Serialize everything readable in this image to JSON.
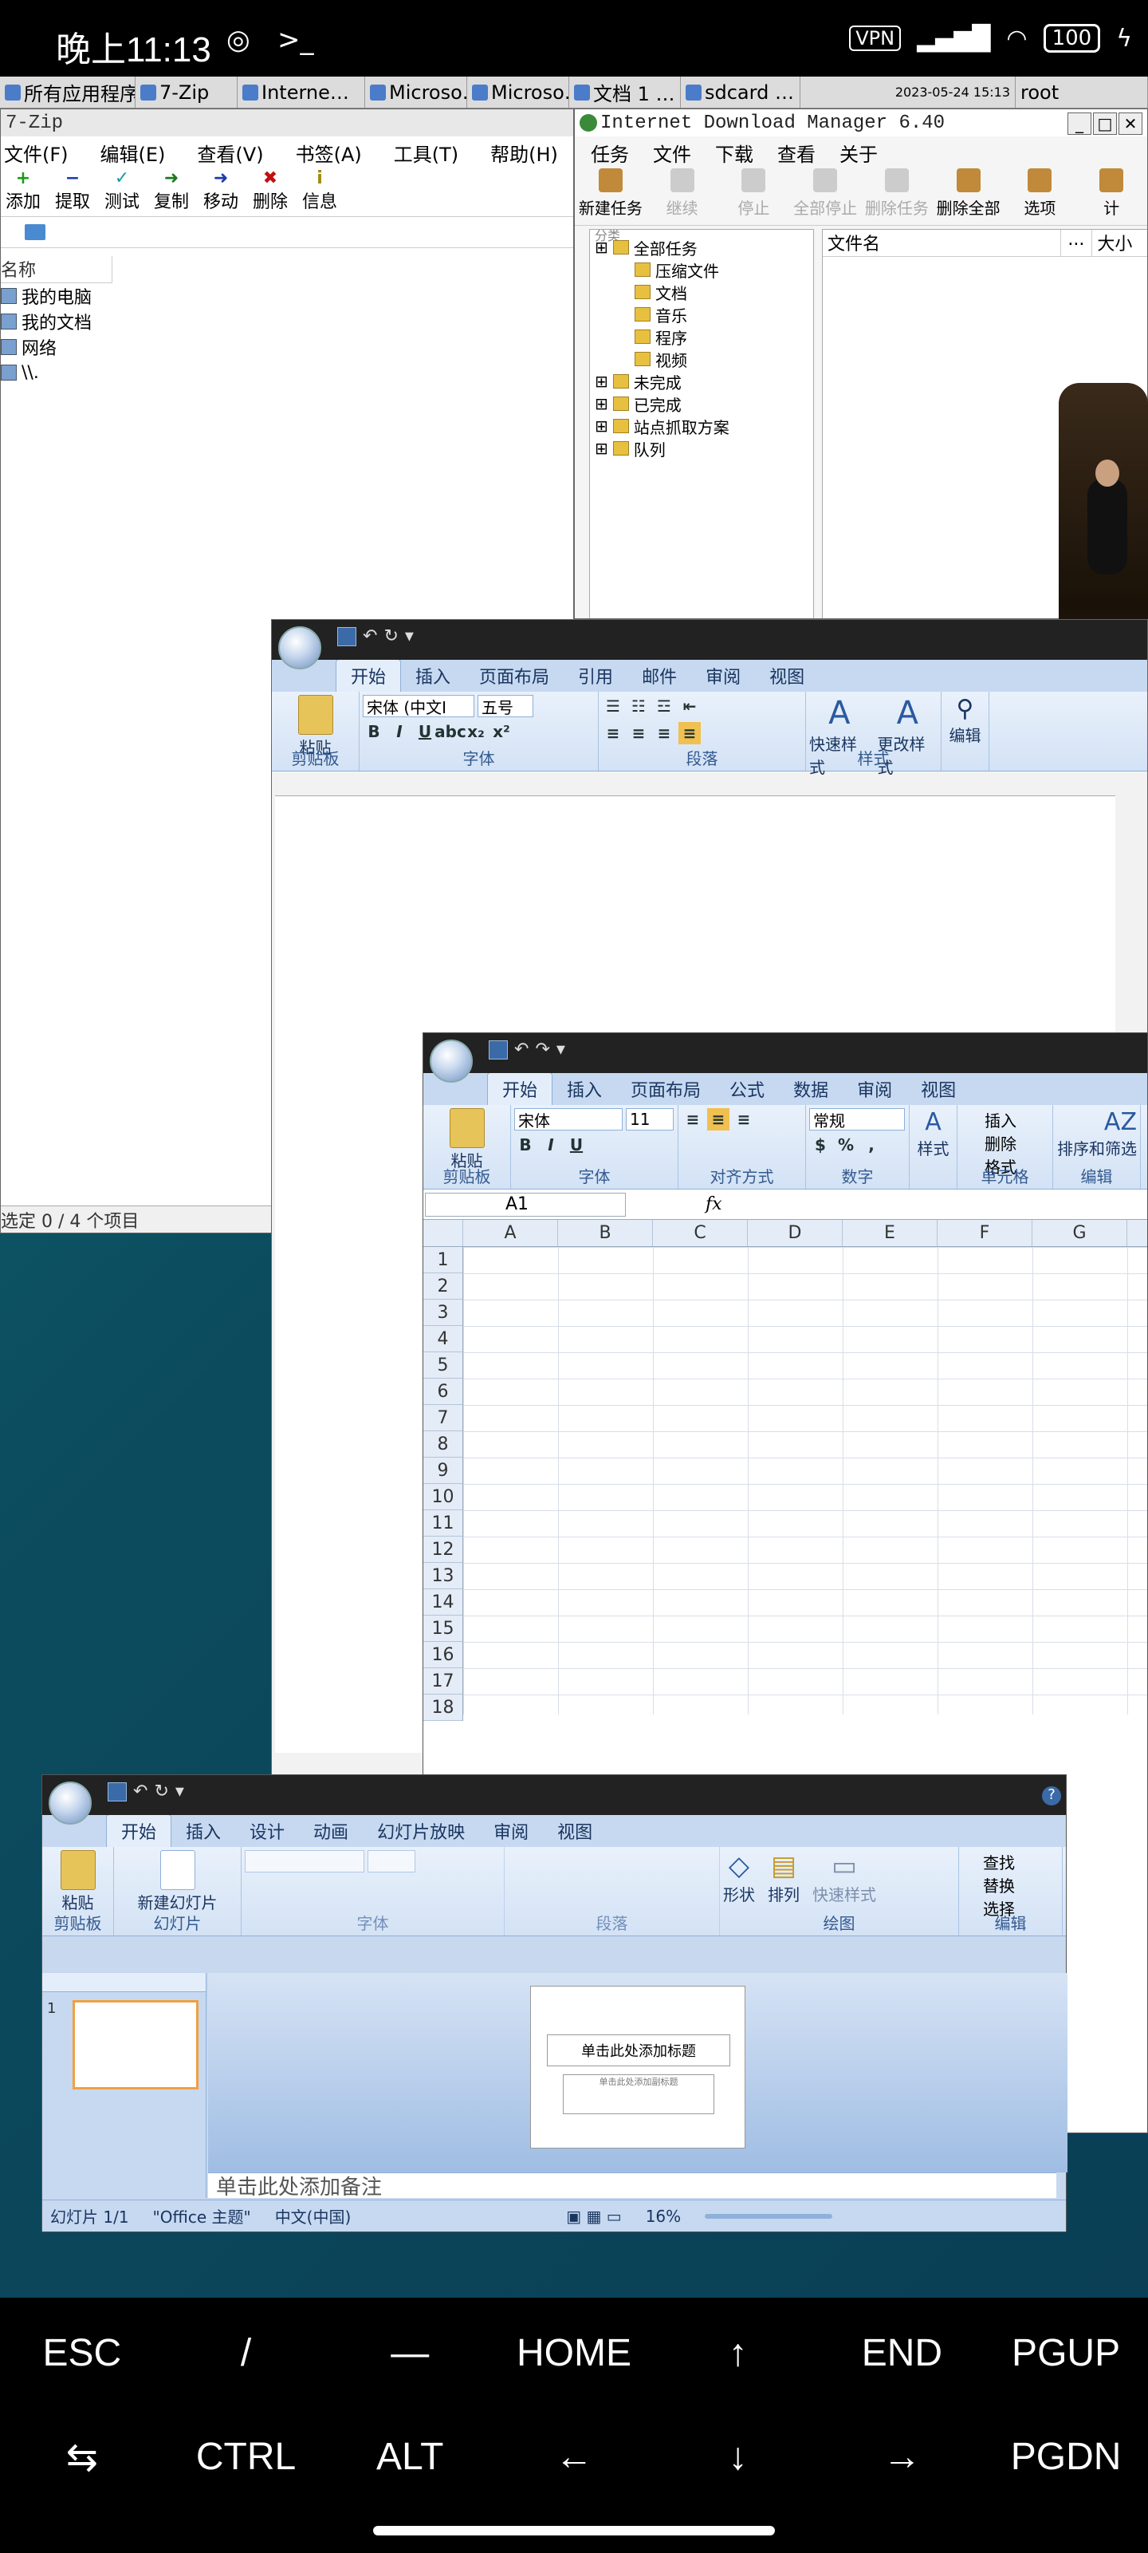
{
  "status_bar": {
    "time": "晚上11:13",
    "vpn": "VPN",
    "battery": "100"
  },
  "taskbar": {
    "items": [
      "所有应用程序",
      "7-Zip",
      "Interne…",
      "Microso…",
      "Microso…",
      "文档 1 …",
      "sdcard …",
      "root"
    ],
    "clock": "2023-05-24 15:13"
  },
  "zip": {
    "title": "7-Zip",
    "menu": [
      "文件(F)",
      "编辑(E)",
      "查看(V)",
      "书签(A)",
      "工具(T)",
      "帮助(H)"
    ],
    "tools": [
      {
        "label": "添加",
        "glyph": "+",
        "color": "#1a9a1a"
      },
      {
        "label": "提取",
        "glyph": "−",
        "color": "#1a3ab0"
      },
      {
        "label": "测试",
        "glyph": "✓",
        "color": "#1a9aa0"
      },
      {
        "label": "复制",
        "glyph": "➜",
        "color": "#1a7a1a"
      },
      {
        "label": "移动",
        "glyph": "➜",
        "color": "#1a3ab0"
      },
      {
        "label": "删除",
        "glyph": "✖",
        "color": "#c01010"
      },
      {
        "label": "信息",
        "glyph": "i",
        "color": "#a08a10"
      }
    ],
    "column_name": "名称",
    "rows": [
      "我的电脑",
      "我的文档",
      "网络",
      "\\\\."
    ],
    "status": "选定 0 / 4 个项目"
  },
  "idm": {
    "title": "Internet Download Manager 6.40",
    "menu": [
      "任务",
      "文件",
      "下载",
      "查看",
      "关于"
    ],
    "tools": [
      {
        "label": "新建任务",
        "enabled": true
      },
      {
        "label": "继续",
        "enabled": false
      },
      {
        "label": "停止",
        "enabled": false
      },
      {
        "label": "全部停止",
        "enabled": false
      },
      {
        "label": "删除任务",
        "enabled": false
      },
      {
        "label": "删除全部",
        "enabled": true
      },
      {
        "label": "选项",
        "enabled": true
      },
      {
        "label": "计",
        "enabled": true
      }
    ],
    "tree_header": "分类",
    "tree": [
      {
        "label": "全部任务",
        "level": 0
      },
      {
        "label": "压缩文件",
        "level": 1
      },
      {
        "label": "文档",
        "level": 1
      },
      {
        "label": "音乐",
        "level": 1
      },
      {
        "label": "程序",
        "level": 1
      },
      {
        "label": "视频",
        "level": 1
      },
      {
        "label": "未完成",
        "level": 0
      },
      {
        "label": "已完成",
        "level": 0
      },
      {
        "label": "站点抓取方案",
        "level": 0
      },
      {
        "label": "队列",
        "level": 0
      }
    ],
    "columns": [
      "文件名",
      "...",
      "大小"
    ]
  },
  "word": {
    "tabs": [
      "开始",
      "插入",
      "页面布局",
      "引用",
      "邮件",
      "审阅",
      "视图"
    ],
    "font": "宋体 (中文I",
    "size": "五号",
    "paste": "粘贴",
    "quick_style": "快速样式",
    "change_style": "更改样式",
    "edit": "编辑",
    "groups": [
      "剪贴板",
      "字体",
      "段落",
      "样式"
    ]
  },
  "excel": {
    "tabs": [
      "开始",
      "插入",
      "页面布局",
      "公式",
      "数据",
      "审阅",
      "视图"
    ],
    "font": "宋体",
    "size": "11",
    "number_format": "常规",
    "paste": "粘贴",
    "style": "样式",
    "insert": "插入",
    "delete": "删除",
    "format": "格式",
    "sort": "排序和筛选",
    "groups": [
      "剪贴板",
      "字体",
      "对齐方式",
      "数字",
      "单元格",
      "编辑"
    ],
    "name_box": "A1",
    "fx": "fx",
    "columns": [
      "A",
      "B",
      "C",
      "D",
      "E",
      "F",
      "G"
    ],
    "rows": [
      "1",
      "2",
      "3",
      "4",
      "5",
      "6",
      "7",
      "8",
      "9",
      "10",
      "11",
      "12",
      "13",
      "14",
      "15",
      "16",
      "17",
      "18"
    ]
  },
  "ppt": {
    "tabs": [
      "开始",
      "插入",
      "设计",
      "动画",
      "幻灯片放映",
      "审阅",
      "视图"
    ],
    "paste": "粘贴",
    "new_slide": "新建幻灯片",
    "shape": "形状",
    "arrange": "排列",
    "quick_style": "快速样式",
    "find": "查找",
    "replace": "替换",
    "select": "选择",
    "groups": [
      "剪贴板",
      "幻灯片",
      "字体",
      "段落",
      "绘图",
      "编辑"
    ],
    "slide_number": "1",
    "slide_title": "单击此处添加标题",
    "slide_subtitle": "单击此处添加副标题",
    "notes": "单击此处添加备注",
    "status": {
      "slide": "幻灯片 1/1",
      "theme": "\"Office 主题\"",
      "lang": "中文(中国)",
      "zoom": "16%"
    }
  },
  "keys": {
    "row1": [
      "ESC",
      "/",
      "—",
      "HOME",
      "↑",
      "END",
      "PGUP"
    ],
    "row2": [
      "⇆",
      "CTRL",
      "ALT",
      "←",
      "↓",
      "→",
      "PGDN"
    ]
  }
}
